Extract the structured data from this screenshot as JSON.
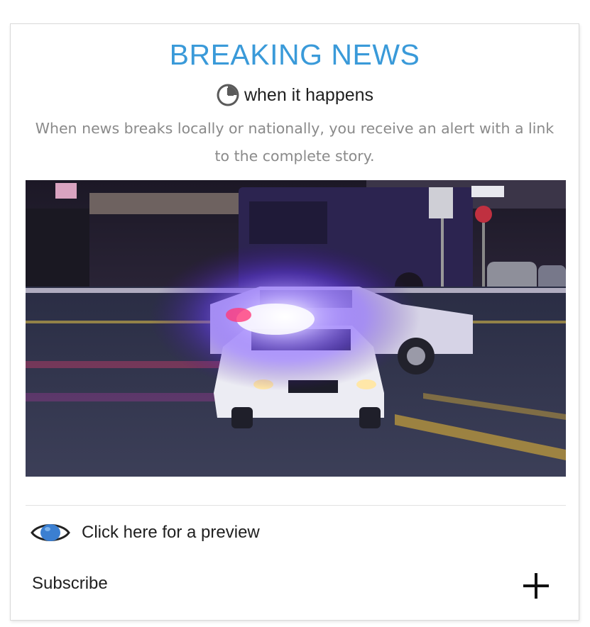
{
  "card": {
    "title": "BREAKING NEWS",
    "subtitle": "when it happens",
    "subtitle_icon": "clock-icon",
    "description": "When news breaks locally or nationally, you receive an alert with a link to the complete story.",
    "image_alt_icon": "police-car-photo",
    "preview_icon": "eye-icon",
    "preview_label": "Click here for a preview",
    "subscribe_label": "Subscribe",
    "subscribe_icon": "plus-icon"
  },
  "colors": {
    "title": "#3a9ad9",
    "eye": "#3b7fd1",
    "text": "#1f1f1f",
    "muted": "#8a8a8a"
  }
}
